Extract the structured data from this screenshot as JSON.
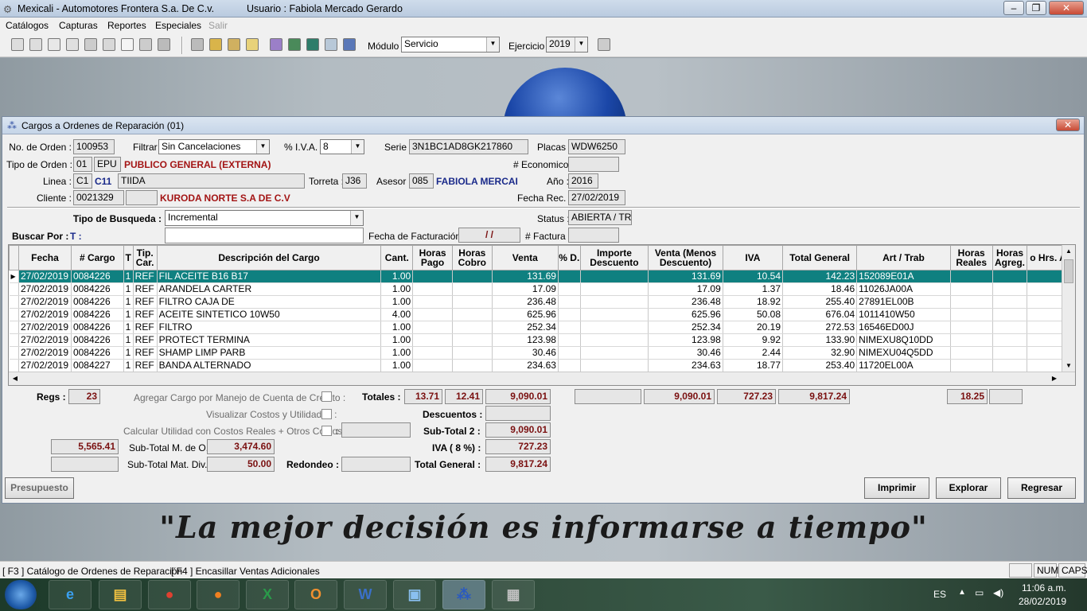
{
  "window": {
    "app_title": "Mexicali - Automotores Frontera S.a. De  C.v.",
    "user_label": "Usuario : Fabiola Mercado Gerardo",
    "min": "–",
    "max": "❐",
    "close": "✕"
  },
  "menu": {
    "items": [
      "Catálogos",
      "Capturas",
      "Reportes",
      "Especiales",
      "Salir"
    ]
  },
  "toolbar": {
    "modulo_label": "Módulo :",
    "modulo_value": "Servicio",
    "ejercicio_label": "Ejercicio :",
    "ejercicio_value": "2019"
  },
  "dialog": {
    "title": "Cargos a Ordenes de Reparación   (01)",
    "no_orden_label": "No. de Orden :",
    "no_orden": "100953",
    "filtrar_label": "Filtrar :",
    "filtrar": "Sin Cancelaciones",
    "iva_label": "% I.V.A. :",
    "iva": "8",
    "serie_label": "Serie :",
    "serie": "3N1BC1AD8GK217860",
    "placas_label": "Placas :",
    "placas": "WDW6250",
    "tipo_orden_label": "Tipo de Orden :",
    "tipo_orden_code": "01",
    "tipo_orden_abbr": "EPU",
    "tipo_orden_desc": "PUBLICO GENERAL (EXTERNA)",
    "economico_label": "# Economico :",
    "economico": "",
    "linea_label": "Linea :",
    "linea_code": "C1",
    "linea_model": "C11",
    "linea_desc": "TIIDA",
    "torreta_label": "Torreta :",
    "torreta": "J36",
    "asesor_label": "Asesor :",
    "asesor_code": "085",
    "asesor_name": "FABIOLA MERCAI",
    "anio_label": "Año :",
    "anio": "2016",
    "cliente_label": "Cliente :",
    "cliente_code": "0021329",
    "cliente_extra": "",
    "cliente_name": "KURODA NORTE S.A  DE C.V",
    "fecha_rec_label": "Fecha Rec. :",
    "fecha_rec": "27/02/2019",
    "tipo_busqueda_label": "Tipo de Busqueda :",
    "tipo_busqueda": "Incremental",
    "status_label": "Status :",
    "status": "ABIERTA / TR",
    "buscar_label": "Buscar Por :",
    "buscar_by": "T :",
    "buscar_value": "",
    "fecha_fact_label": "Fecha de Facturación :",
    "fecha_fact": "/  /",
    "factura_label": "# Factura :",
    "factura": ""
  },
  "grid": {
    "columns": [
      "",
      "Fecha",
      "# Cargo",
      "T",
      "Tip. Car.",
      "Descripción del Cargo",
      "Cant.",
      "Horas Pago",
      "Horas Cobro",
      "Venta",
      "% D.",
      "Importe Descuento",
      "Venta (Menos Descuento)",
      "IVA",
      "Total General",
      "Art / Trab",
      "Horas Reales",
      "Horas Agreg.",
      "o Hrs. Ag"
    ],
    "rows": [
      {
        "fecha": "27/02/2019",
        "cargo": "0084226",
        "t": "1",
        "tip": "REF",
        "desc": "FIL  ACEITE B16 B17",
        "cant": "1.00",
        "venta": "131.69",
        "venta_md": "131.69",
        "iva": "10.54",
        "total": "142.23",
        "art": "152089E01A"
      },
      {
        "fecha": "27/02/2019",
        "cargo": "0084226",
        "t": "1",
        "tip": "REF",
        "desc": "ARANDELA CARTER",
        "cant": "1.00",
        "venta": "17.09",
        "venta_md": "17.09",
        "iva": "1.37",
        "total": "18.46",
        "art": "11026JA00A"
      },
      {
        "fecha": "27/02/2019",
        "cargo": "0084226",
        "t": "1",
        "tip": "REF",
        "desc": "FILTRO CAJA DE",
        "cant": "1.00",
        "venta": "236.48",
        "venta_md": "236.48",
        "iva": "18.92",
        "total": "255.40",
        "art": "27891EL00B"
      },
      {
        "fecha": "27/02/2019",
        "cargo": "0084226",
        "t": "1",
        "tip": "REF",
        "desc": "ACEITE SINTETICO 10W50",
        "cant": "4.00",
        "venta": "625.96",
        "venta_md": "625.96",
        "iva": "50.08",
        "total": "676.04",
        "art": "1011410W50"
      },
      {
        "fecha": "27/02/2019",
        "cargo": "0084226",
        "t": "1",
        "tip": "REF",
        "desc": "FILTRO",
        "cant": "1.00",
        "venta": "252.34",
        "venta_md": "252.34",
        "iva": "20.19",
        "total": "272.53",
        "art": "16546ED00J"
      },
      {
        "fecha": "27/02/2019",
        "cargo": "0084226",
        "t": "1",
        "tip": "REF",
        "desc": "PROTECT TERMINA",
        "cant": "1.00",
        "venta": "123.98",
        "venta_md": "123.98",
        "iva": "9.92",
        "total": "133.90",
        "art": "NIMEXU8Q10DD"
      },
      {
        "fecha": "27/02/2019",
        "cargo": "0084226",
        "t": "1",
        "tip": "REF",
        "desc": "SHAMP LIMP PARB",
        "cant": "1.00",
        "venta": "30.46",
        "venta_md": "30.46",
        "iva": "2.44",
        "total": "32.90",
        "art": "NIMEXU04Q5DD"
      },
      {
        "fecha": "27/02/2019",
        "cargo": "0084227",
        "t": "1",
        "tip": "REF",
        "desc": "BANDA ALTERNADO",
        "cant": "1.00",
        "venta": "234.63",
        "venta_md": "234.63",
        "iva": "18.77",
        "total": "253.40",
        "art": "11720EL00A"
      }
    ]
  },
  "totals": {
    "regs_label": "Regs :",
    "regs": "23",
    "agregar_label": "Agregar Cargo por Manejo de Cuenta de Crédito :",
    "totales_label": "Totales :",
    "horas_pago": "13.71",
    "horas_cobro": "12.41",
    "venta": "9,090.01",
    "importe_desc": "",
    "venta_md": "9,090.01",
    "iva": "727.23",
    "total_general": "9,817.24",
    "horas_reales": "18.25",
    "horas_agreg": "",
    "visualizar_label": "Visualizar Costos y Utilidades :",
    "descuentos_label": "Descuentos :",
    "descuentos": "",
    "calcular_label": "Calcular Utilidad con Costos Reales + Otros Costos :",
    "calcular_colon": ":",
    "calcular_value": "",
    "subtotal2_label": "Sub-Total 2 :",
    "subtotal2": "9,090.01",
    "left_value": "5,565.41",
    "subtotal_mo_label": "Sub-Total M. de O. :",
    "subtotal_mo": "3,474.60",
    "iva8_label": "IVA ( 8 %) :",
    "iva8": "727.23",
    "left_value2": "",
    "subtotal_mat_label": "Sub-Total Mat. Div. :",
    "subtotal_mat": "50.00",
    "redondeo_label": "Redondeo :",
    "redondeo": "",
    "total_general_label": "Total General :",
    "total_general2": "9,817.24"
  },
  "buttons": {
    "presupuesto": "Presupuesto",
    "imprimir": "Imprimir",
    "explorar": "Explorar",
    "regresar": "Regresar"
  },
  "slogan": "\"La mejor decisión es informarse a tiempo\"",
  "statusbar": {
    "f3": "[ F3 ] Catálogo de Ordenes de Reparación",
    "f4": "[ F4 ] Encasillar Ventas Adicionales",
    "num": "NUM",
    "caps": "CAPS"
  },
  "taskbar": {
    "lang": "ES",
    "time": "11:06 a.m.",
    "date": "28/02/2019"
  }
}
